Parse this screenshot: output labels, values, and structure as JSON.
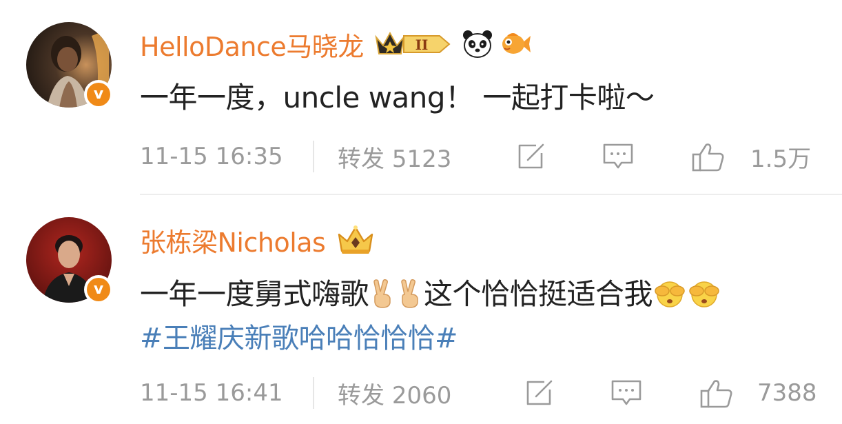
{
  "posts": [
    {
      "username": "HelloDance马晓龙",
      "avatar_icon": "avatar-portrait",
      "badges": [
        "crown-level-badge",
        "panda-icon",
        "goldfish-icon"
      ],
      "badge_level": "II",
      "verified_letter": "v",
      "comment_text": "一年一度，uncle wang！ 一起打卡啦～",
      "timestamp": "11-15 16:35",
      "repost_label": "转发",
      "repost_count": "5123",
      "like_count": "1.5万"
    },
    {
      "username": "张栋梁Nicholas",
      "avatar_icon": "avatar-portrait",
      "badges": [
        "crown-badge"
      ],
      "verified_letter": "v",
      "comment_text_a": "一年一度舅式嗨歌",
      "comment_text_b": "这个恰恰挺适合我",
      "emojis": [
        "victory-hand-icon",
        "victory-hand-icon",
        "cover-eyes-icon",
        "cover-eyes-icon"
      ],
      "hashtag": "#王耀庆新歌哈哈恰恰恰#",
      "timestamp": "11-15 16:41",
      "repost_label": "转发",
      "repost_count": "2060",
      "like_count": "7388"
    }
  ],
  "colors": {
    "username": "#ec7b2f",
    "hashtag": "#4a7fb8",
    "meta": "#9a9a9a",
    "verified": "#f08a17"
  }
}
